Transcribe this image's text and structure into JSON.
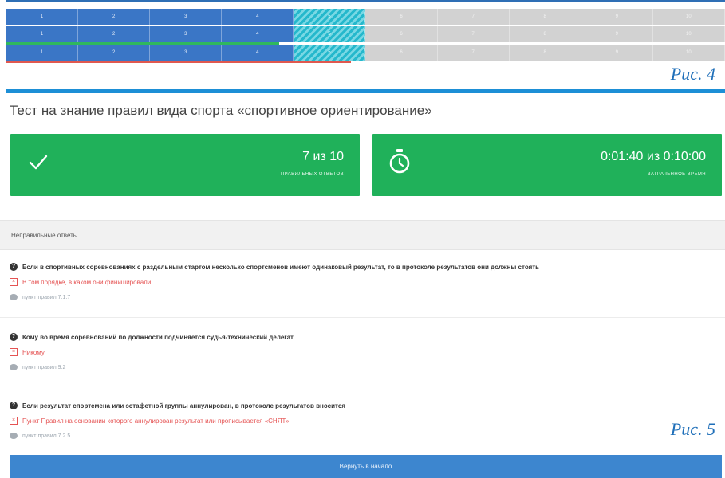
{
  "figure4": {
    "caption": "Рис. 4",
    "bars": [
      {
        "done": [
          "1",
          "2",
          "3",
          "4"
        ],
        "current": [
          "5"
        ],
        "todo": [
          "6",
          "7",
          "8",
          "9",
          "10"
        ],
        "line_color": "#ffffff",
        "line_progress": 0.38
      },
      {
        "done": [
          "1",
          "2",
          "3",
          "4"
        ],
        "current": [
          "5"
        ],
        "todo": [
          "6",
          "7",
          "8",
          "9",
          "10"
        ],
        "line_color": "#2fb85e",
        "line_progress": 0.38
      },
      {
        "done": [
          "1",
          "2",
          "3",
          "4"
        ],
        "current": [
          "5"
        ],
        "todo": [
          "6",
          "7",
          "8",
          "9",
          "10"
        ],
        "line_color": "#e0584f",
        "line_progress": 0.48
      }
    ]
  },
  "figure5": {
    "caption": "Рис. 5",
    "title": "Тест на знание правил вида спорта «спортивное ориентирование»",
    "score_card": {
      "value": "7 из 10",
      "label": "ПРАВИЛЬНЫХ ОТВЕТОВ",
      "icon": "checkmark-icon"
    },
    "time_card": {
      "value": "0:01:40 из 0:10:00",
      "label": "ЗАТРАЧЕННОЕ ВРЕМЯ",
      "icon": "stopwatch-icon"
    },
    "section_title": "Неправильные ответы",
    "questions": [
      {
        "question": "Если в спортивных соревнованиях с раздельным стартом несколько спортсменов имеют одинаковый результат, то в протоколе результатов они должны стоять",
        "answer": "В том порядке, в каком они финишировали",
        "rule": "пункт правил 7.1.7"
      },
      {
        "question": "Кому во время соревнований по должности подчиняется судья-технический делегат",
        "answer": "Никому",
        "rule": "пункт правил 9.2"
      },
      {
        "question": "Если результат спортсмена или эстафетной группы аннулирован, в протоколе результатов вносится",
        "answer": "Пункт Правил на основании которого аннулирован результат или прописывается «СНЯТ»",
        "rule": "пункт правил 7.2.5"
      }
    ],
    "back_button": "Вернуть в начало",
    "colors": {
      "card_green": "#20b15a",
      "accent_blue": "#1d8fd6",
      "error_red": "#e55353",
      "button_blue": "#3d86cf"
    }
  }
}
